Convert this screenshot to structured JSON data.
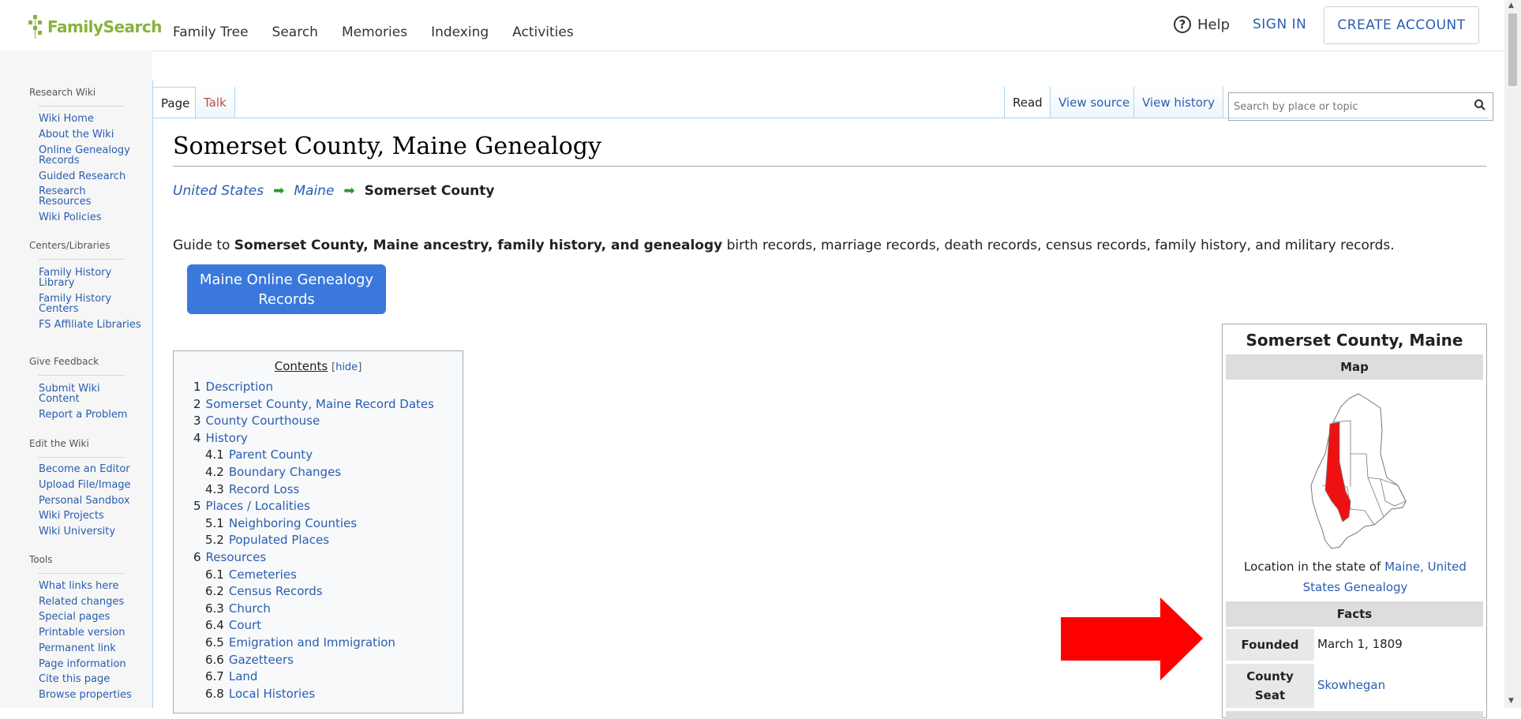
{
  "header": {
    "logo_text": "FamilySearch",
    "nav": [
      "Family Tree",
      "Search",
      "Memories",
      "Indexing",
      "Activities"
    ],
    "help_label": "Help",
    "sign_in_label": "SIGN IN",
    "create_account_label": "CREATE ACCOUNT"
  },
  "sidebar": {
    "sections": [
      {
        "heading": "Research Wiki",
        "links": [
          "Wiki Home",
          "About the Wiki",
          "Online Genealogy Records",
          "Guided Research",
          "Research Resources",
          "Wiki Policies"
        ]
      },
      {
        "heading": "Centers/Libraries",
        "links": [
          "Family History Library",
          "Family History Centers",
          "FS Affiliate Libraries"
        ]
      },
      {
        "heading": "Give Feedback",
        "links": [
          "Submit Wiki Content",
          "Report a Problem"
        ]
      },
      {
        "heading": "Edit the Wiki",
        "links": [
          "Become an Editor",
          "Upload File/Image",
          "Personal Sandbox",
          "Wiki Projects",
          "Wiki University"
        ]
      },
      {
        "heading": "Tools",
        "links": [
          "What links here",
          "Related changes",
          "Special pages",
          "Printable version",
          "Permanent link",
          "Page information",
          "Cite this page",
          "Browse properties"
        ]
      }
    ]
  },
  "tabs": {
    "page": "Page",
    "talk": "Talk",
    "read": "Read",
    "view_source": "View source",
    "view_history": "View history"
  },
  "search": {
    "placeholder": "Search by place or topic"
  },
  "article": {
    "title": "Somerset County, Maine Genealogy",
    "breadcrumb": [
      "United States",
      "Maine",
      "Somerset County"
    ],
    "guide_prefix": "Guide to ",
    "guide_bold": "Somerset County, Maine ancestry, family history, and genealogy",
    "guide_rest": " birth records, marriage records, death records, census records, family history, and military records.",
    "records_button": "Maine Online Genealogy Records"
  },
  "toc": {
    "title": "Contents",
    "hide_label": "hide",
    "items": [
      {
        "num": "1",
        "label": "Description",
        "level": 1
      },
      {
        "num": "2",
        "label": "Somerset County, Maine Record Dates",
        "level": 1
      },
      {
        "num": "3",
        "label": "County Courthouse",
        "level": 1
      },
      {
        "num": "4",
        "label": "History",
        "level": 1
      },
      {
        "num": "4.1",
        "label": "Parent County",
        "level": 2
      },
      {
        "num": "4.2",
        "label": "Boundary Changes",
        "level": 2
      },
      {
        "num": "4.3",
        "label": "Record Loss",
        "level": 2
      },
      {
        "num": "5",
        "label": "Places / Localities",
        "level": 1
      },
      {
        "num": "5.1",
        "label": "Neighboring Counties",
        "level": 2
      },
      {
        "num": "5.2",
        "label": "Populated Places",
        "level": 2
      },
      {
        "num": "6",
        "label": "Resources",
        "level": 1
      },
      {
        "num": "6.1",
        "label": "Cemeteries",
        "level": 2
      },
      {
        "num": "6.2",
        "label": "Census Records",
        "level": 2
      },
      {
        "num": "6.3",
        "label": "Church",
        "level": 2
      },
      {
        "num": "6.4",
        "label": "Court",
        "level": 2
      },
      {
        "num": "6.5",
        "label": "Emigration and Immigration",
        "level": 2
      },
      {
        "num": "6.6",
        "label": "Gazetteers",
        "level": 2
      },
      {
        "num": "6.7",
        "label": "Land",
        "level": 2
      },
      {
        "num": "6.8",
        "label": "Local Histories",
        "level": 2
      }
    ]
  },
  "infobox": {
    "title": "Somerset County, Maine",
    "map_band": "Map",
    "caption_prefix": "Location in the state of ",
    "caption_link": "Maine, United States Genealogy",
    "facts_band": "Facts",
    "founded_label": "Founded",
    "founded_value": "March 1, 1809",
    "seat_label": "County Seat",
    "seat_value": "Skowhegan"
  },
  "colors": {
    "link": "#2a5db0",
    "button": "#3a78dc",
    "arrow": "#ff0000",
    "logo": "#87b33c"
  }
}
